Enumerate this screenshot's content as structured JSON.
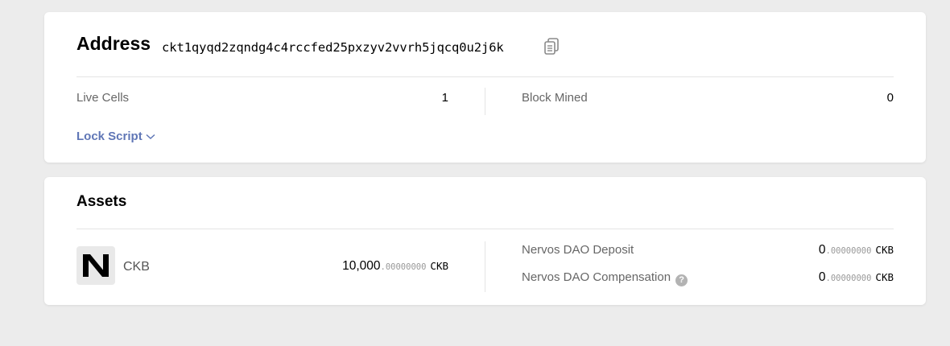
{
  "address": {
    "title": "Address",
    "hash": "ckt1qyqd2zqndg4c4rccfed25pxzyv2vvrh5jqcq0u2j6k",
    "live_cells_label": "Live Cells",
    "live_cells_value": "1",
    "block_mined_label": "Block Mined",
    "block_mined_value": "0",
    "lock_script_label": "Lock Script"
  },
  "assets": {
    "title": "Assets",
    "ckb": {
      "name": "CKB",
      "int": "10,000",
      "dec": ".00000000",
      "unit": "CKB"
    },
    "dao_deposit": {
      "label": "Nervos DAO Deposit",
      "int": "0",
      "dec": ".00000000",
      "unit": "CKB"
    },
    "dao_compensation": {
      "label": "Nervos DAO Compensation",
      "int": "0",
      "dec": ".00000000",
      "unit": "CKB",
      "help_glyph": "?"
    }
  },
  "icons": {
    "copy": "copy-icon",
    "chevron": "chevron-down-icon",
    "help": "help-icon",
    "logo": "nervos-logo-icon"
  },
  "colors": {
    "link": "#5f76b6",
    "background": "#ececec"
  }
}
